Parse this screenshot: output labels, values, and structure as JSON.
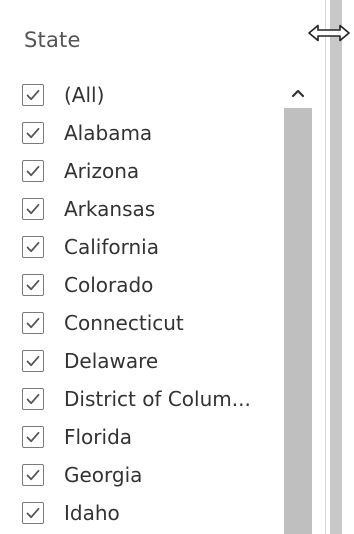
{
  "filter": {
    "title": "State",
    "items": [
      {
        "label": "(All)",
        "checked": true
      },
      {
        "label": "Alabama",
        "checked": true
      },
      {
        "label": "Arizona",
        "checked": true
      },
      {
        "label": "Arkansas",
        "checked": true
      },
      {
        "label": "California",
        "checked": true
      },
      {
        "label": "Colorado",
        "checked": true
      },
      {
        "label": "Connecticut",
        "checked": true
      },
      {
        "label": "Delaware",
        "checked": true
      },
      {
        "label": "District of Colum...",
        "checked": true
      },
      {
        "label": "Florida",
        "checked": true
      },
      {
        "label": "Georgia",
        "checked": true
      },
      {
        "label": "Idaho",
        "checked": true
      }
    ]
  },
  "icons": {
    "checkbox": "checkmark-icon",
    "scroll_up": "chevron-up-icon",
    "resize": "horizontal-resize-icon"
  },
  "colors": {
    "scrollbar": "#bfbfbf",
    "side_bar": "#c8c8c8",
    "title_text": "#555555",
    "item_text": "#333333"
  }
}
